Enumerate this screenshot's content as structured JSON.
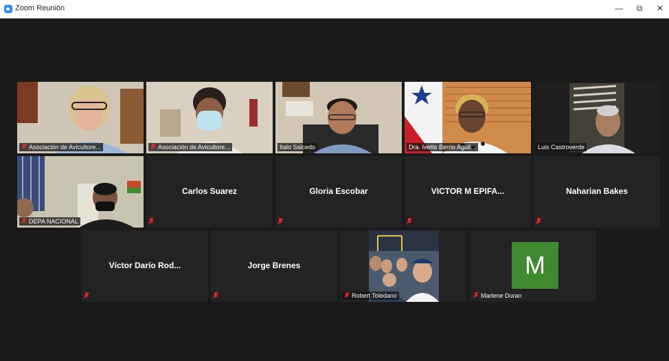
{
  "window": {
    "title": "Zoom Reunión",
    "minimize_symbol": "—",
    "maximize_symbol": "⧉",
    "close_symbol": "✕"
  },
  "participants": [
    {
      "name": "Asociación de Avicultore...",
      "video": true,
      "muted": true
    },
    {
      "name": "Asociación de Avicultore...",
      "video": true,
      "muted": true
    },
    {
      "name": "Italo Salcedo",
      "video": true,
      "muted": false
    },
    {
      "name": "Dra. Ivette Berrio Aguil...",
      "video": true,
      "muted": false
    },
    {
      "name": "Luis Castroverde",
      "video": true,
      "muted": false,
      "active_speaker": true
    },
    {
      "name": "DEPA NACIONAL",
      "video": true,
      "muted": true
    },
    {
      "name": "Carlos Suarez",
      "video": false,
      "muted": true
    },
    {
      "name": "Gloria Escobar",
      "video": false,
      "muted": true
    },
    {
      "name": "VICTOR M EPIFA...",
      "video": false,
      "muted": true
    },
    {
      "name": "Naharian Bakes",
      "video": false,
      "muted": true
    },
    {
      "name": "Víctor Darío Rod...",
      "video": false,
      "muted": true
    },
    {
      "name": "Jorge Brenes",
      "video": false,
      "muted": true
    },
    {
      "name": "Robert Toledano",
      "video": true,
      "muted": true
    },
    {
      "name": "Marlene Duran",
      "video": false,
      "muted": true,
      "avatar_letter": "M",
      "avatar_color": "#3f8a2f"
    }
  ],
  "colors": {
    "background": "#1a1a1a",
    "tile": "#232323",
    "active_border": "#c9d56b",
    "muted_icon": "#e02828"
  }
}
